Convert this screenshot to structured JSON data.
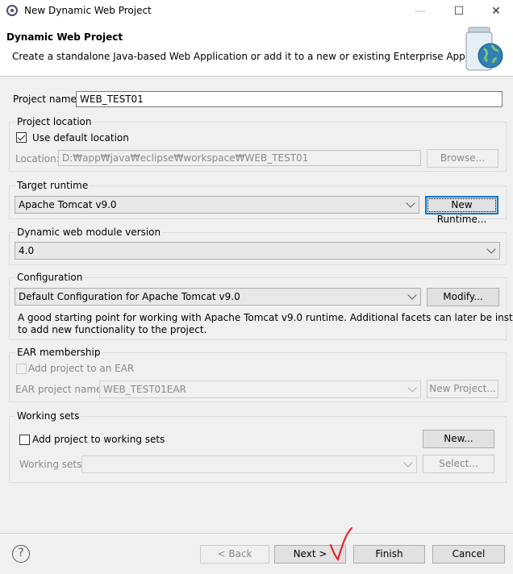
{
  "window": {
    "title": "New Dynamic Web Project",
    "minimize": "—",
    "maximize": "☐",
    "close": "✕"
  },
  "header": {
    "title": "Dynamic Web Project",
    "description": "Create a standalone Java-based Web Application or add it to a new or existing Enterprise Application."
  },
  "project_name": {
    "label": "Project name:",
    "value": "WEB_TEST01"
  },
  "project_location": {
    "group_label": "Project location",
    "use_default_label": "Use default location",
    "use_default_checked": true,
    "location_label": "Location:",
    "location_value": "D:₩app₩java₩eclipse₩workspace₩WEB_TEST01",
    "browse_label": "Browse..."
  },
  "target_runtime": {
    "group_label": "Target runtime",
    "selected": "Apache Tomcat v9.0",
    "new_runtime_label": "New Runtime..."
  },
  "web_module": {
    "group_label": "Dynamic web module version",
    "selected": "4.0"
  },
  "configuration": {
    "group_label": "Configuration",
    "selected": "Default Configuration for Apache Tomcat v9.0",
    "modify_label": "Modify...",
    "description_line1": "A good starting point for working with Apache Tomcat v9.0 runtime. Additional facets can later be installed",
    "description_line2": "to add new functionality to the project."
  },
  "ear": {
    "group_label": "EAR membership",
    "add_label": "Add project to an EAR",
    "add_checked": false,
    "name_label": "EAR project name:",
    "name_value": "WEB_TEST01EAR",
    "new_project_label": "New Project..."
  },
  "working_sets": {
    "group_label": "Working sets",
    "add_label": "Add project to working sets",
    "add_checked": false,
    "new_label": "New...",
    "sets_label": "Working sets:",
    "select_label": "Select..."
  },
  "footer": {
    "help": "?",
    "back_label": "< Back",
    "next_label": "Next >",
    "finish_label": "Finish",
    "cancel_label": "Cancel"
  },
  "colors": {
    "focus": "#0078d7",
    "annotation": "#e8171b"
  }
}
